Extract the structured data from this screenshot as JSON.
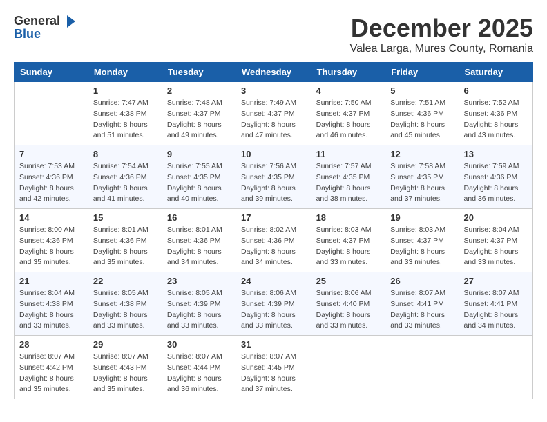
{
  "logo": {
    "general": "General",
    "blue": "Blue"
  },
  "title": "December 2025",
  "location": "Valea Larga, Mures County, Romania",
  "weekdays": [
    "Sunday",
    "Monday",
    "Tuesday",
    "Wednesday",
    "Thursday",
    "Friday",
    "Saturday"
  ],
  "weeks": [
    [
      {
        "day": "",
        "sunrise": "",
        "sunset": "",
        "daylight": ""
      },
      {
        "day": "1",
        "sunrise": "Sunrise: 7:47 AM",
        "sunset": "Sunset: 4:38 PM",
        "daylight": "Daylight: 8 hours and 51 minutes."
      },
      {
        "day": "2",
        "sunrise": "Sunrise: 7:48 AM",
        "sunset": "Sunset: 4:37 PM",
        "daylight": "Daylight: 8 hours and 49 minutes."
      },
      {
        "day": "3",
        "sunrise": "Sunrise: 7:49 AM",
        "sunset": "Sunset: 4:37 PM",
        "daylight": "Daylight: 8 hours and 47 minutes."
      },
      {
        "day": "4",
        "sunrise": "Sunrise: 7:50 AM",
        "sunset": "Sunset: 4:37 PM",
        "daylight": "Daylight: 8 hours and 46 minutes."
      },
      {
        "day": "5",
        "sunrise": "Sunrise: 7:51 AM",
        "sunset": "Sunset: 4:36 PM",
        "daylight": "Daylight: 8 hours and 45 minutes."
      },
      {
        "day": "6",
        "sunrise": "Sunrise: 7:52 AM",
        "sunset": "Sunset: 4:36 PM",
        "daylight": "Daylight: 8 hours and 43 minutes."
      }
    ],
    [
      {
        "day": "7",
        "sunrise": "Sunrise: 7:53 AM",
        "sunset": "Sunset: 4:36 PM",
        "daylight": "Daylight: 8 hours and 42 minutes."
      },
      {
        "day": "8",
        "sunrise": "Sunrise: 7:54 AM",
        "sunset": "Sunset: 4:36 PM",
        "daylight": "Daylight: 8 hours and 41 minutes."
      },
      {
        "day": "9",
        "sunrise": "Sunrise: 7:55 AM",
        "sunset": "Sunset: 4:35 PM",
        "daylight": "Daylight: 8 hours and 40 minutes."
      },
      {
        "day": "10",
        "sunrise": "Sunrise: 7:56 AM",
        "sunset": "Sunset: 4:35 PM",
        "daylight": "Daylight: 8 hours and 39 minutes."
      },
      {
        "day": "11",
        "sunrise": "Sunrise: 7:57 AM",
        "sunset": "Sunset: 4:35 PM",
        "daylight": "Daylight: 8 hours and 38 minutes."
      },
      {
        "day": "12",
        "sunrise": "Sunrise: 7:58 AM",
        "sunset": "Sunset: 4:35 PM",
        "daylight": "Daylight: 8 hours and 37 minutes."
      },
      {
        "day": "13",
        "sunrise": "Sunrise: 7:59 AM",
        "sunset": "Sunset: 4:36 PM",
        "daylight": "Daylight: 8 hours and 36 minutes."
      }
    ],
    [
      {
        "day": "14",
        "sunrise": "Sunrise: 8:00 AM",
        "sunset": "Sunset: 4:36 PM",
        "daylight": "Daylight: 8 hours and 35 minutes."
      },
      {
        "day": "15",
        "sunrise": "Sunrise: 8:01 AM",
        "sunset": "Sunset: 4:36 PM",
        "daylight": "Daylight: 8 hours and 35 minutes."
      },
      {
        "day": "16",
        "sunrise": "Sunrise: 8:01 AM",
        "sunset": "Sunset: 4:36 PM",
        "daylight": "Daylight: 8 hours and 34 minutes."
      },
      {
        "day": "17",
        "sunrise": "Sunrise: 8:02 AM",
        "sunset": "Sunset: 4:36 PM",
        "daylight": "Daylight: 8 hours and 34 minutes."
      },
      {
        "day": "18",
        "sunrise": "Sunrise: 8:03 AM",
        "sunset": "Sunset: 4:37 PM",
        "daylight": "Daylight: 8 hours and 33 minutes."
      },
      {
        "day": "19",
        "sunrise": "Sunrise: 8:03 AM",
        "sunset": "Sunset: 4:37 PM",
        "daylight": "Daylight: 8 hours and 33 minutes."
      },
      {
        "day": "20",
        "sunrise": "Sunrise: 8:04 AM",
        "sunset": "Sunset: 4:37 PM",
        "daylight": "Daylight: 8 hours and 33 minutes."
      }
    ],
    [
      {
        "day": "21",
        "sunrise": "Sunrise: 8:04 AM",
        "sunset": "Sunset: 4:38 PM",
        "daylight": "Daylight: 8 hours and 33 minutes."
      },
      {
        "day": "22",
        "sunrise": "Sunrise: 8:05 AM",
        "sunset": "Sunset: 4:38 PM",
        "daylight": "Daylight: 8 hours and 33 minutes."
      },
      {
        "day": "23",
        "sunrise": "Sunrise: 8:05 AM",
        "sunset": "Sunset: 4:39 PM",
        "daylight": "Daylight: 8 hours and 33 minutes."
      },
      {
        "day": "24",
        "sunrise": "Sunrise: 8:06 AM",
        "sunset": "Sunset: 4:39 PM",
        "daylight": "Daylight: 8 hours and 33 minutes."
      },
      {
        "day": "25",
        "sunrise": "Sunrise: 8:06 AM",
        "sunset": "Sunset: 4:40 PM",
        "daylight": "Daylight: 8 hours and 33 minutes."
      },
      {
        "day": "26",
        "sunrise": "Sunrise: 8:07 AM",
        "sunset": "Sunset: 4:41 PM",
        "daylight": "Daylight: 8 hours and 33 minutes."
      },
      {
        "day": "27",
        "sunrise": "Sunrise: 8:07 AM",
        "sunset": "Sunset: 4:41 PM",
        "daylight": "Daylight: 8 hours and 34 minutes."
      }
    ],
    [
      {
        "day": "28",
        "sunrise": "Sunrise: 8:07 AM",
        "sunset": "Sunset: 4:42 PM",
        "daylight": "Daylight: 8 hours and 35 minutes."
      },
      {
        "day": "29",
        "sunrise": "Sunrise: 8:07 AM",
        "sunset": "Sunset: 4:43 PM",
        "daylight": "Daylight: 8 hours and 35 minutes."
      },
      {
        "day": "30",
        "sunrise": "Sunrise: 8:07 AM",
        "sunset": "Sunset: 4:44 PM",
        "daylight": "Daylight: 8 hours and 36 minutes."
      },
      {
        "day": "31",
        "sunrise": "Sunrise: 8:07 AM",
        "sunset": "Sunset: 4:45 PM",
        "daylight": "Daylight: 8 hours and 37 minutes."
      },
      {
        "day": "",
        "sunrise": "",
        "sunset": "",
        "daylight": ""
      },
      {
        "day": "",
        "sunrise": "",
        "sunset": "",
        "daylight": ""
      },
      {
        "day": "",
        "sunrise": "",
        "sunset": "",
        "daylight": ""
      }
    ]
  ]
}
